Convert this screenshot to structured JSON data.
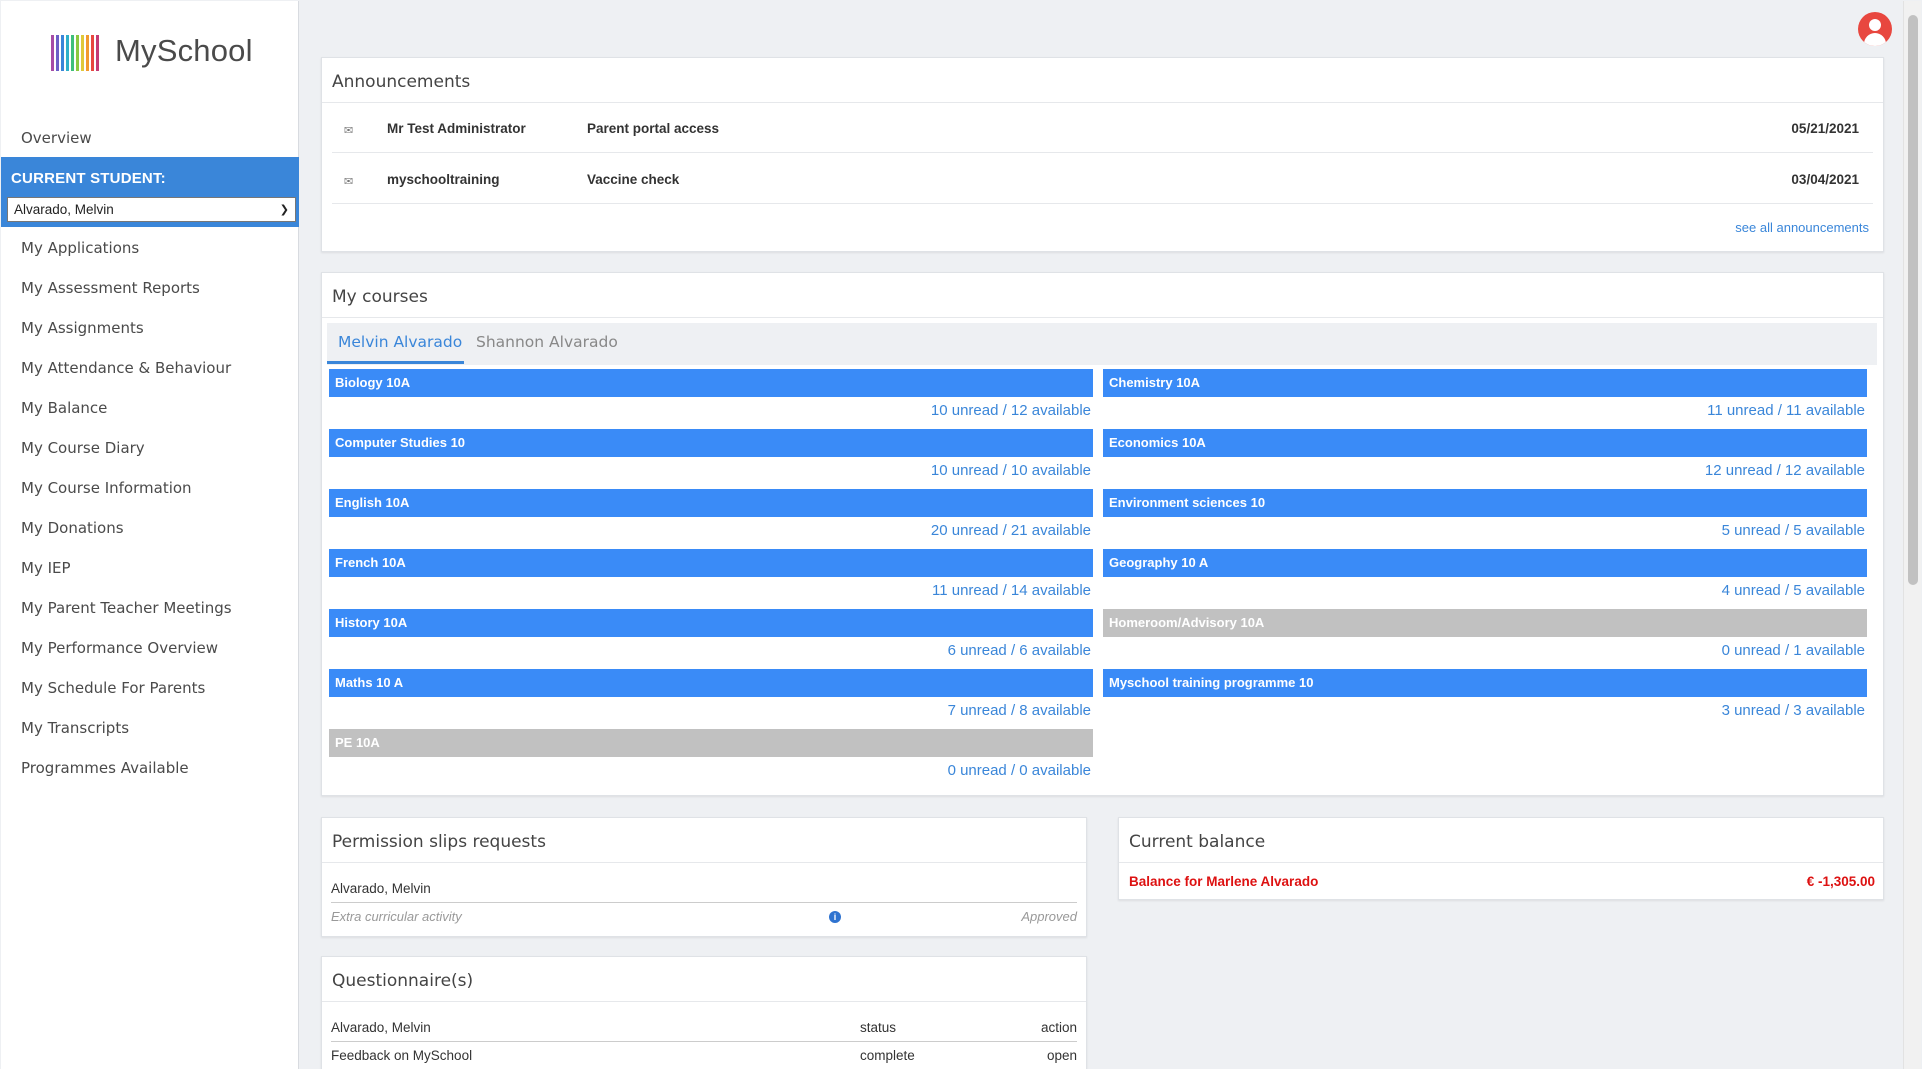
{
  "app": {
    "name": "MySchool"
  },
  "logo_colors": [
    "#a64ca6",
    "#6b5fc7",
    "#3a86d9",
    "#2fb0c9",
    "#3fbf7a",
    "#8cc83f",
    "#e0c83a",
    "#f29a2e",
    "#e8473f",
    "#c43b74"
  ],
  "sidebar": {
    "overview": "Overview",
    "current_student_label": "CURRENT STUDENT:",
    "current_student_value": "Alvarado, Melvin",
    "items": [
      "My Applications",
      "My Assessment Reports",
      "My Assignments",
      "My Attendance & Behaviour",
      "My Balance",
      "My Course Diary",
      "My Course Information",
      "My Donations",
      "My IEP",
      "My Parent Teacher Meetings",
      "My Performance Overview",
      "My Schedule For Parents",
      "My Transcripts",
      "Programmes Available"
    ]
  },
  "announcements": {
    "title": "Announcements",
    "rows": [
      {
        "sender": "Mr Test Administrator",
        "subject": "Parent portal access",
        "date": "05/21/2021"
      },
      {
        "sender": "myschooltraining",
        "subject": "Vaccine check",
        "date": "03/04/2021"
      }
    ],
    "see_all": "see all announcements"
  },
  "courses": {
    "title": "My courses",
    "tabs": [
      "Melvin Alvarado",
      "Shannon Alvarado"
    ],
    "list": [
      {
        "name": "Biology 10A",
        "stats": "10 unread / 12 available",
        "active": true
      },
      {
        "name": "Chemistry 10A",
        "stats": "11 unread / 11 available",
        "active": true
      },
      {
        "name": "Computer Studies 10",
        "stats": "10 unread / 10 available",
        "active": true
      },
      {
        "name": "Economics 10A",
        "stats": "12 unread / 12 available",
        "active": true
      },
      {
        "name": "English 10A",
        "stats": "20 unread / 21 available",
        "active": true
      },
      {
        "name": "Environment sciences 10",
        "stats": "5 unread / 5 available",
        "active": true
      },
      {
        "name": "French 10A",
        "stats": "11 unread / 14 available",
        "active": true
      },
      {
        "name": "Geography 10 A",
        "stats": "4 unread / 5 available",
        "active": true
      },
      {
        "name": "History 10A",
        "stats": "6 unread / 6 available",
        "active": true
      },
      {
        "name": "Homeroom/Advisory 10A",
        "stats": "0 unread / 1 available",
        "active": false
      },
      {
        "name": "Maths 10 A",
        "stats": "7 unread / 8 available",
        "active": true
      },
      {
        "name": "Myschool training programme 10",
        "stats": "3 unread / 3 available",
        "active": true
      },
      {
        "name": "PE 10A",
        "stats": "0 unread / 0 available",
        "active": false
      }
    ]
  },
  "permission": {
    "title": "Permission slips requests",
    "student": "Alvarado, Melvin",
    "activity": "Extra curricular activity",
    "status": "Approved"
  },
  "balance": {
    "title": "Current balance",
    "label": "Balance for Marlene Alvarado",
    "value": "€ -1,305.00"
  },
  "questionnaire": {
    "title": "Questionnaire(s)",
    "student": "Alvarado, Melvin",
    "col_status": "status",
    "col_action": "action",
    "row_name": "Feedback on MySchool",
    "row_status": "complete",
    "row_action": "open"
  }
}
